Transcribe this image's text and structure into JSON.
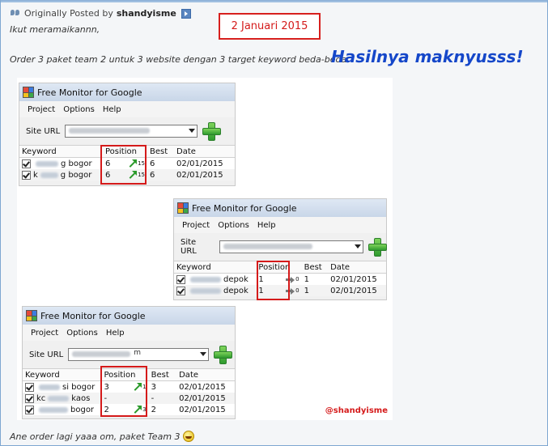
{
  "quote": {
    "prefix": "Originally Posted by",
    "author": "shandyisme",
    "date_note": "2 Januari 2015",
    "line1": "Ikut meramaikannn,",
    "line2": "Order 3 paket team 2 untuk 3 website dengan 3 target keyword beda-beda.",
    "highlight": "Hasilnya maknyusss!",
    "footer": "Ane order lagi yaaa om, paket Team 3"
  },
  "colors": {
    "accent_red": "#d51a1a",
    "highlight_blue": "#1547c9",
    "trend_green": "#2b9a2b"
  },
  "app": {
    "title": "Free Monitor for Google",
    "menu": [
      "Project",
      "Options",
      "Help"
    ],
    "site_url_label": "Site URL",
    "columns": [
      "Keyword",
      "Position",
      "Best",
      "Date"
    ],
    "watermark": "@shandyisme"
  },
  "windows": [
    {
      "rows": [
        {
          "kw_prefix": "",
          "kw_suffix": "g bogor",
          "position": "6",
          "trend": "up",
          "change": "15",
          "best": "6",
          "date": "02/01/2015"
        },
        {
          "kw_prefix": "k",
          "kw_suffix": "g bogor",
          "position": "6",
          "trend": "up",
          "change": "15",
          "best": "6",
          "date": "02/01/2015"
        }
      ]
    },
    {
      "rows": [
        {
          "kw_prefix": "",
          "kw_suffix": "depok",
          "position": "1",
          "trend": "same",
          "change": "0",
          "best": "1",
          "date": "02/01/2015"
        },
        {
          "kw_prefix": "",
          "kw_suffix": "depok",
          "position": "1",
          "trend": "same",
          "change": "0",
          "best": "1",
          "date": "02/01/2015"
        }
      ]
    },
    {
      "url_fragment": "m",
      "rows": [
        {
          "kw_prefix": "",
          "kw_suffix": "si bogor",
          "position": "3",
          "trend": "up",
          "change": "1",
          "best": "3",
          "date": "02/01/2015"
        },
        {
          "kw_prefix": "kc",
          "kw_suffix": "kaos",
          "position": "-",
          "trend": "",
          "change": "",
          "best": "-",
          "date": "02/01/2015"
        },
        {
          "kw_prefix": "",
          "kw_suffix": "bogor",
          "position": "2",
          "trend": "up",
          "change": "3",
          "best": "2",
          "date": "02/01/2015"
        }
      ]
    }
  ]
}
